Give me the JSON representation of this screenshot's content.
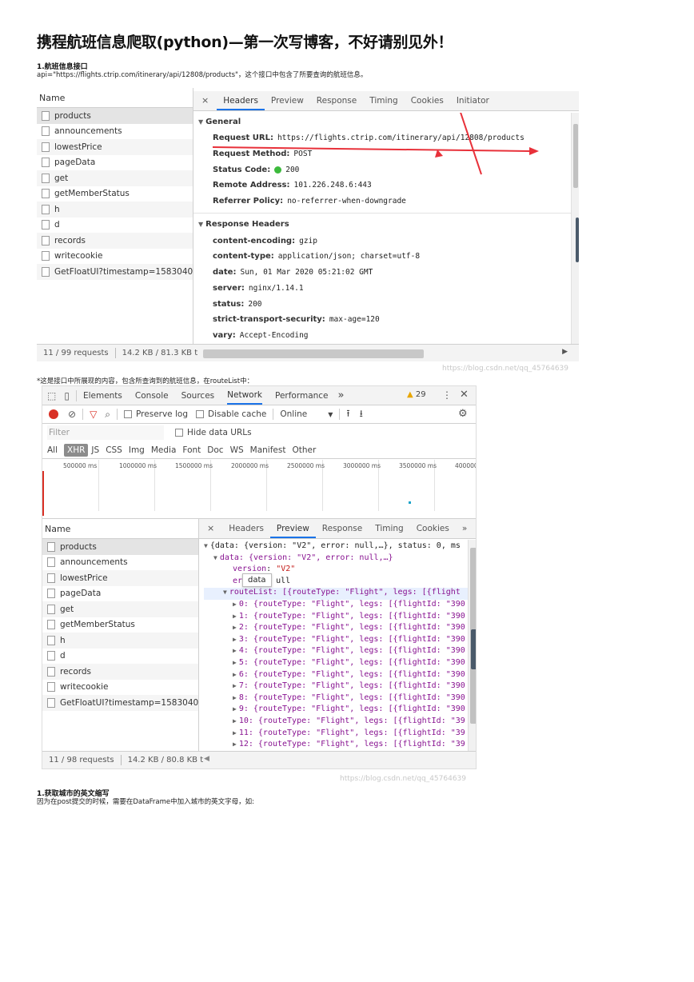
{
  "title": "携程航班信息爬取(python)—第一次写博客，不好请别见外！",
  "section1": {
    "heading": "1.航班信息接口",
    "text": "api=\"https://flights.ctrip.com/itinerary/api/12808/products\"，这个接口中包含了所要查询的航班信息。"
  },
  "panel1": {
    "name_header": "Name",
    "requests": [
      "products",
      "announcements",
      "lowestPrice",
      "pageData",
      "get",
      "getMemberStatus",
      "h",
      "d",
      "records",
      "writecookie",
      "GetFloatUI?timestamp=15830400..."
    ],
    "tabs": [
      "Headers",
      "Preview",
      "Response",
      "Timing",
      "Cookies",
      "Initiator"
    ],
    "close": "×",
    "general_title": "General",
    "general": [
      {
        "k": "Request URL:",
        "v": "https://flights.ctrip.com/itinerary/api/12808/products"
      },
      {
        "k": "Request Method:",
        "v": "POST"
      },
      {
        "k": "Status Code:",
        "v": "200"
      },
      {
        "k": "Remote Address:",
        "v": "101.226.248.6:443"
      },
      {
        "k": "Referrer Policy:",
        "v": "no-referrer-when-downgrade"
      }
    ],
    "response_title": "Response Headers",
    "response": [
      {
        "k": "content-encoding:",
        "v": "gzip"
      },
      {
        "k": "content-type:",
        "v": "application/json; charset=utf-8"
      },
      {
        "k": "date:",
        "v": "Sun, 01 Mar 2020 05:21:02 GMT"
      },
      {
        "k": "server:",
        "v": "nginx/1.14.1"
      },
      {
        "k": "status:",
        "v": "200"
      },
      {
        "k": "strict-transport-security:",
        "v": "max-age=120"
      },
      {
        "k": "vary:",
        "v": "Accept-Encoding"
      }
    ],
    "footer_count": "11 / 99 requests",
    "footer_size": "14.2 KB / 81.3 KB t",
    "status_color": "#3cba3c",
    "arrow_color": "#e8313a"
  },
  "caption2": "*这是接口中所展现的内容，包含所查询到的航班信息，在routeList中：",
  "panel2": {
    "top_tabs": [
      "Elements",
      "Console",
      "Sources",
      "Network",
      "Performance"
    ],
    "more": "»",
    "warn_count": "29",
    "preserve_log": "Preserve log",
    "disable_cache": "Disable cache",
    "online": "Online",
    "filter_placeholder": "Filter",
    "hide_data_urls": "Hide data URLs",
    "type_filters": [
      "All",
      "XHR",
      "JS",
      "CSS",
      "Img",
      "Media",
      "Font",
      "Doc",
      "WS",
      "Manifest",
      "Other"
    ],
    "timeline": [
      "500000 ms",
      "1000000 ms",
      "1500000 ms",
      "2000000 ms",
      "2500000 ms",
      "3000000 ms",
      "3500000 ms",
      "4000000"
    ],
    "name_header": "Name",
    "requests": [
      "products",
      "announcements",
      "lowestPrice",
      "pageData",
      "get",
      "getMemberStatus",
      "h",
      "d",
      "records",
      "writecookie",
      "GetFloatUI?timestamp=15830400..."
    ],
    "detail_tabs": [
      "Headers",
      "Preview",
      "Response",
      "Timing",
      "Cookies"
    ],
    "tooltip": "data",
    "json": {
      "root": "{data: {version: \"V2\", error: null,…}, status: 0, ms",
      "data": "data: {version: \"V2\", error: null,…}",
      "version_key": "version",
      "version_val": "\"V2\"",
      "error_key": "err",
      "error_val": "ull",
      "routelist": "routeList: [{routeType: \"Flight\", legs: [{flight",
      "items": [
        "0: {routeType: \"Flight\", legs: [{flightId: \"390",
        "1: {routeType: \"Flight\", legs: [{flightId: \"390",
        "2: {routeType: \"Flight\", legs: [{flightId: \"390",
        "3: {routeType: \"Flight\", legs: [{flightId: \"390",
        "4: {routeType: \"Flight\", legs: [{flightId: \"390",
        "5: {routeType: \"Flight\", legs: [{flightId: \"390",
        "6: {routeType: \"Flight\", legs: [{flightId: \"390",
        "7: {routeType: \"Flight\", legs: [{flightId: \"390",
        "8: {routeType: \"Flight\", legs: [{flightId: \"390",
        "9: {routeType: \"Flight\", legs: [{flightId: \"390",
        "10: {routeType: \"Flight\", legs: [{flightId: \"39",
        "11: {routeType: \"Flight\", legs: [{flightId: \"39",
        "12: {routeType: \"Flight\", legs: [{flightId: \"39"
      ]
    },
    "footer_count": "11 / 98 requests",
    "footer_size": "14.2 KB / 80.8 KB t"
  },
  "section2": {
    "heading": "1.获取城市的英文缩写",
    "text": "因为在post提交的时候，需要在DataFrame中加入城市的英文字母，如:"
  },
  "watermark1": "https://blog.csdn.net/qq_45764639",
  "watermark2": "https://blog.csdn.net/qq_45764639"
}
